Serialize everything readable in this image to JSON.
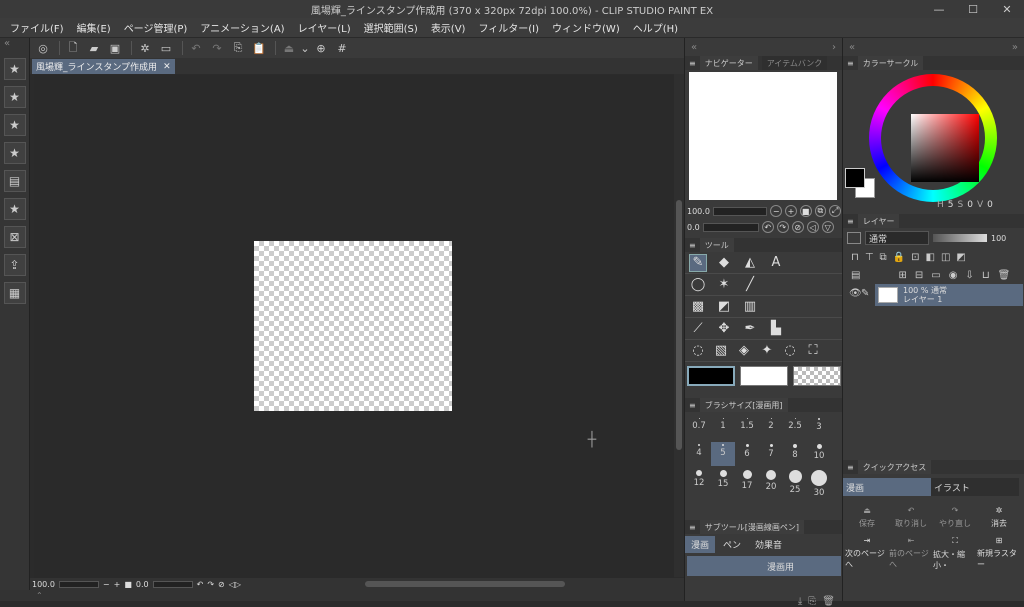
{
  "window": {
    "title": "風場輝_ラインスタンプ作成用 (370 x 320px 72dpi 100.0%) - CLIP STUDIO PAINT EX",
    "minimize": "—",
    "maximize": "☐",
    "close": "✕"
  },
  "menu": [
    "ファイル(F)",
    "編集(E)",
    "ページ管理(P)",
    "アニメーション(A)",
    "レイヤー(L)",
    "選択範囲(S)",
    "表示(V)",
    "フィルター(I)",
    "ウィンドウ(W)",
    "ヘルプ(H)"
  ],
  "document": {
    "tab_label": "風場輝_ラインスタンプ作成用",
    "tab_close": "✕"
  },
  "status": {
    "zoom": "100.0",
    "angle": "0.0",
    "minus": "−",
    "plus": "+"
  },
  "navigator": {
    "tab_label": "ナビゲーター",
    "tab2_label": "アイテムバンク",
    "zoom": "100.0",
    "angle": "0.0"
  },
  "tool_panel": {
    "title": "ツール",
    "colors": {
      "main": "#000000",
      "sub": "#ffffff"
    }
  },
  "brush_size": {
    "title": "ブラシサイズ[漫画用]",
    "sizes": [
      {
        "label": "0.7",
        "dot": 1
      },
      {
        "label": "1",
        "dot": 1
      },
      {
        "label": "1.5",
        "dot": 1
      },
      {
        "label": "2",
        "dot": 1
      },
      {
        "label": "2.5",
        "dot": 1
      },
      {
        "label": "3",
        "dot": 2
      },
      {
        "label": "4",
        "dot": 2
      },
      {
        "label": "5",
        "dot": 2,
        "selected": true
      },
      {
        "label": "6",
        "dot": 3
      },
      {
        "label": "7",
        "dot": 3
      },
      {
        "label": "8",
        "dot": 4
      },
      {
        "label": "10",
        "dot": 5
      },
      {
        "label": "12",
        "dot": 6
      },
      {
        "label": "15",
        "dot": 7
      },
      {
        "label": "17",
        "dot": 9
      },
      {
        "label": "20",
        "dot": 10
      },
      {
        "label": "25",
        "dot": 13
      },
      {
        "label": "30",
        "dot": 16
      }
    ]
  },
  "subtool": {
    "title": "サブツール[漫画線画ペン]",
    "tabs": [
      "漫画",
      "ペン",
      "効果音"
    ],
    "item": "漫画用"
  },
  "color_circle": {
    "tab_label": "カラーサークル",
    "values": {
      "h": "5",
      "s": "0",
      "v": "0"
    },
    "h_label": "H",
    "s_label": "S",
    "v_label": "V"
  },
  "layer_panel": {
    "tab_label": "レイヤー",
    "blend_mode": "通常",
    "opacity": "100",
    "layer": {
      "opacity_label": "100 % 通常",
      "name": "レイヤー 1"
    }
  },
  "quick_access": {
    "tab_label": "クイックアクセス",
    "tabs": [
      "漫画",
      "イラスト"
    ],
    "buttons": [
      "保存",
      "取り消し",
      "やり直し",
      "消去"
    ],
    "buttons2": [
      "次のページへ",
      "前のページへ",
      "拡大・縮小・",
      "新規ラスター"
    ]
  }
}
